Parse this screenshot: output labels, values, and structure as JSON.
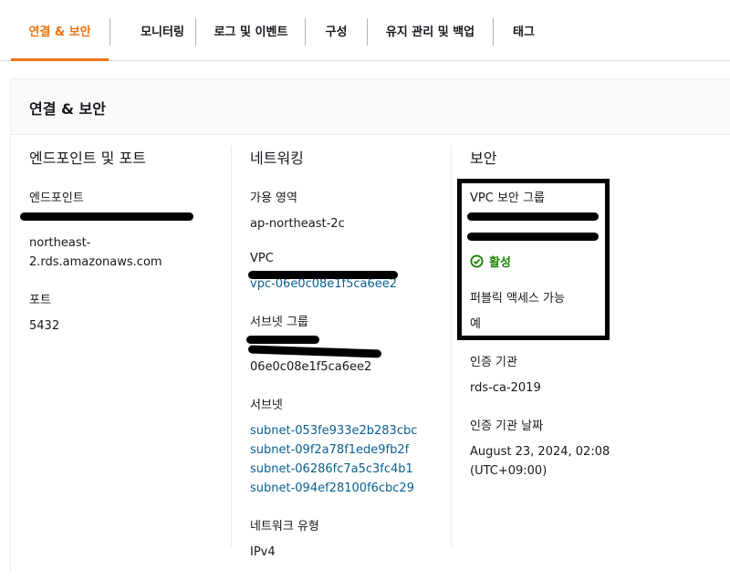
{
  "tabs": [
    {
      "label": "연결 & 보안",
      "active": true
    },
    {
      "label": "모니터링",
      "active": false
    },
    {
      "label": "로그 및 이벤트",
      "active": false
    },
    {
      "label": "구성",
      "active": false
    },
    {
      "label": "유지 관리 및 백업",
      "active": false
    },
    {
      "label": "태그",
      "active": false
    }
  ],
  "panel": {
    "title": "연결 & 보안"
  },
  "endpoint_section": {
    "title": "엔드포인트 및 포트",
    "endpoint_label": "엔드포인트",
    "endpoint_value_lines": [
      "northeast-",
      "2.rds.amazonaws.com"
    ],
    "port_label": "포트",
    "port_value": "5432"
  },
  "networking": {
    "title": "네트워킹",
    "az_label": "가용 영역",
    "az_value": "ap-northeast-2c",
    "vpc_label": "VPC",
    "vpc_value": "vpc-06e0c08e1f5ca6ee2",
    "subnet_group_label": "서브넷 그룹",
    "subnet_group_value": "06e0c08e1f5ca6ee2",
    "subnets_label": "서브넷",
    "subnets": [
      "subnet-053fe933e2b283cbc",
      "subnet-09f2a78f1ede9fb2f",
      "subnet-06286fc7a5c3fc4b1",
      "subnet-094ef28100f6cbc29"
    ],
    "network_type_label": "네트워크 유형",
    "network_type_value": "IPv4"
  },
  "security": {
    "title": "보안",
    "vpc_sg_label": "VPC 보안 그룹",
    "vpc_sg_status": "활성",
    "public_access_label": "퍼블릭 액세스 가능",
    "public_access_value": "예",
    "ca_label": "인증 기관",
    "ca_value": "rds-ca-2019",
    "ca_date_label": "인증 기관 날짜",
    "ca_date_lines": [
      "August 23, 2024, 02:08",
      "(UTC+09:00)"
    ]
  },
  "colors": {
    "accent": "#ec7211",
    "link": "#0a5f8f",
    "success": "#1d8102"
  }
}
